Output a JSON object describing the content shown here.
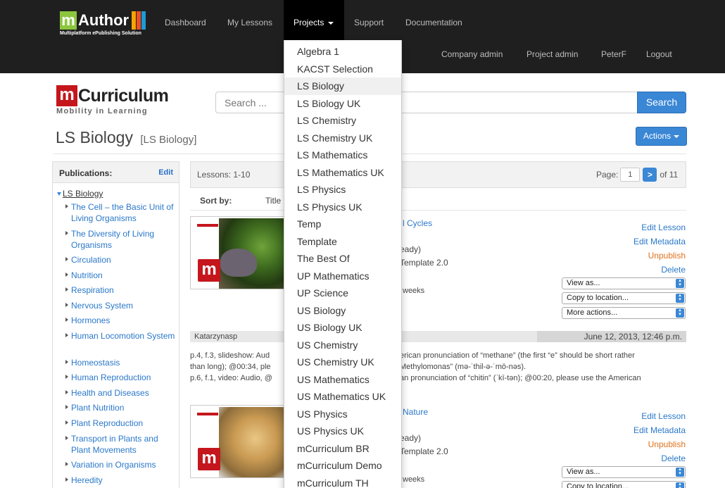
{
  "brand": {
    "letter": "m",
    "word": "Author",
    "tagline": "Multiplatform ePublishing Solution",
    "block_colors": [
      "#f7a400",
      "#f04e23",
      "#1d9ad6"
    ]
  },
  "nav": {
    "items": [
      "Dashboard",
      "My Lessons",
      "Projects",
      "Support",
      "Documentation"
    ],
    "right": [
      "Company admin",
      "Project admin",
      "PeterF",
      "Logout"
    ]
  },
  "dropdown": {
    "items": [
      "Algebra 1",
      "KACST Selection",
      "LS Biology",
      "LS Biology UK",
      "LS Chemistry",
      "LS Chemistry UK",
      "LS Mathematics",
      "LS Mathematics UK",
      "LS Physics",
      "LS Physics UK",
      "Temp",
      "Template",
      "The Best Of",
      "UP Mathematics",
      "UP Science",
      "US Biology",
      "US Biology UK",
      "US Chemistry",
      "US Chemistry UK",
      "US Mathematics",
      "US Mathematics UK",
      "US Physics",
      "US Physics UK",
      "mCurriculum BR",
      "mCurriculum Demo",
      "mCurriculum TH"
    ],
    "hovered": "LS Biology"
  },
  "logo": {
    "letter": "m",
    "word": "Curriculum",
    "tagline": "Mobility in Learning"
  },
  "search": {
    "placeholder": "Search ...",
    "button": "Search"
  },
  "page": {
    "title": "LS Biology",
    "subtitle": "[LS Biology]",
    "actions": "Actions"
  },
  "sidebar": {
    "title": "Publications:",
    "edit": "Edit",
    "root": "LS Biology",
    "items": [
      "The Cell – the Basic Unit of Living Organisms",
      "The Diversity of Living Organisms",
      "Circulation",
      "Nutrition",
      "Respiration",
      "Nervous System",
      "Hormones",
      "Human Locomotion System",
      "Homeostasis",
      "Human Reproduction",
      "Health and Diseases",
      "Plant Nutrition",
      "Plant Reproduction",
      "Transport in Plants and Plant Movements",
      "Variation in Organisms",
      "Heredity"
    ]
  },
  "lessons": {
    "count": "Lessons: 1-10",
    "page_label": "Page:",
    "page_value": "1",
    "next": ">",
    "of": "of 11",
    "sort_label": "Sort by:",
    "sort_col": "Title",
    "lesson1": {
      "title": "l Cycles",
      "status": "eady)",
      "template": "Template 2.0",
      "weeks": "weeks"
    },
    "lesson2": {
      "title": "Nature",
      "status": "eady)",
      "template": "Template 2.0",
      "weeks": "weeks"
    },
    "actions": {
      "edit": "Edit Lesson",
      "metadata": "Edit Metadata",
      "unpublish": "Unpublish",
      "delete": "Delete",
      "view_as": "View as...",
      "copy": "Copy to location...",
      "more": "More actions..."
    },
    "comment": {
      "author": "Katarzynasp",
      "date": "June 12, 2013, 12:46 p.m.",
      "line1a": "p.4, f.3, slideshow: Aud",
      "line1b": "erican pronunciation of “methane” (the first “e” should be short rather",
      "line2a": "than long); @00:34, ple",
      "line2b": "Methylomonas” (mə-ˈthil-ə-ˈmō-nəs).",
      "line3a": "p.6, f.1, video: Audio, @",
      "line3b": "an pronunciation of “chitin” (ˈkī-tən); @00:20, please use the American"
    }
  }
}
